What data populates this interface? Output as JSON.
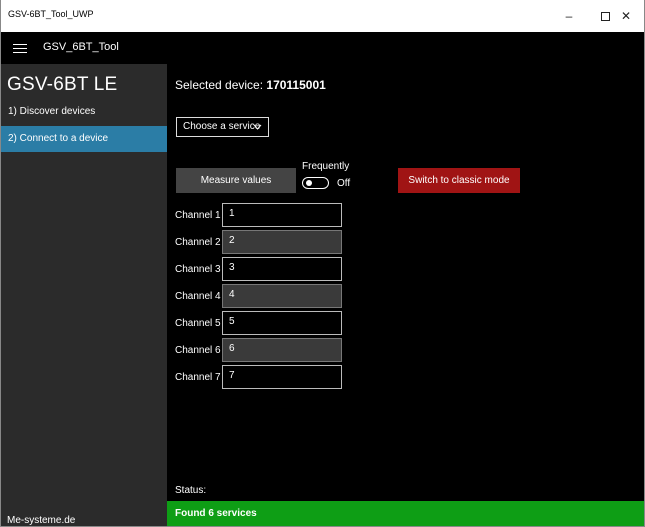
{
  "window": {
    "title": "GSV-6BT_Tool_UWP",
    "minimize": "–",
    "close": "✕"
  },
  "header": {
    "app_name": "GSV_6BT_Tool"
  },
  "sidebar": {
    "heading": "GSV-6BT LE",
    "items": [
      {
        "label": "1) Discover devices",
        "selected": false
      },
      {
        "label": "2) Connect to a device",
        "selected": true
      }
    ],
    "footer": "Me-systeme.de"
  },
  "main": {
    "selected_label": "Selected device: ",
    "selected_value": "170115001",
    "service_dropdown": "Choose a service",
    "measure_button": "Measure values",
    "frequently_label": "Frequently",
    "toggle_state": "Off",
    "classic_button": "Switch to classic mode",
    "channels": [
      {
        "label": "Channel 1",
        "value": "1"
      },
      {
        "label": "Channel 2",
        "value": "2"
      },
      {
        "label": "Channel 3",
        "value": "3"
      },
      {
        "label": "Channel 4",
        "value": "4"
      },
      {
        "label": "Channel 5",
        "value": "5"
      },
      {
        "label": "Channel 6",
        "value": "6"
      },
      {
        "label": "Channel 7",
        "value": "7"
      }
    ],
    "status_label": "Status:",
    "status_message": "Found 6 services"
  },
  "colors": {
    "selected_nav": "#2b7da6",
    "classic_button": "#a01414",
    "status_bar": "#0e9e15",
    "sidebar_bg": "#2b2b2b",
    "main_bg": "#000000"
  },
  "icons": [
    "hamburger-icon",
    "chevron-down-icon",
    "minimize-icon",
    "maximize-icon",
    "close-icon"
  ]
}
